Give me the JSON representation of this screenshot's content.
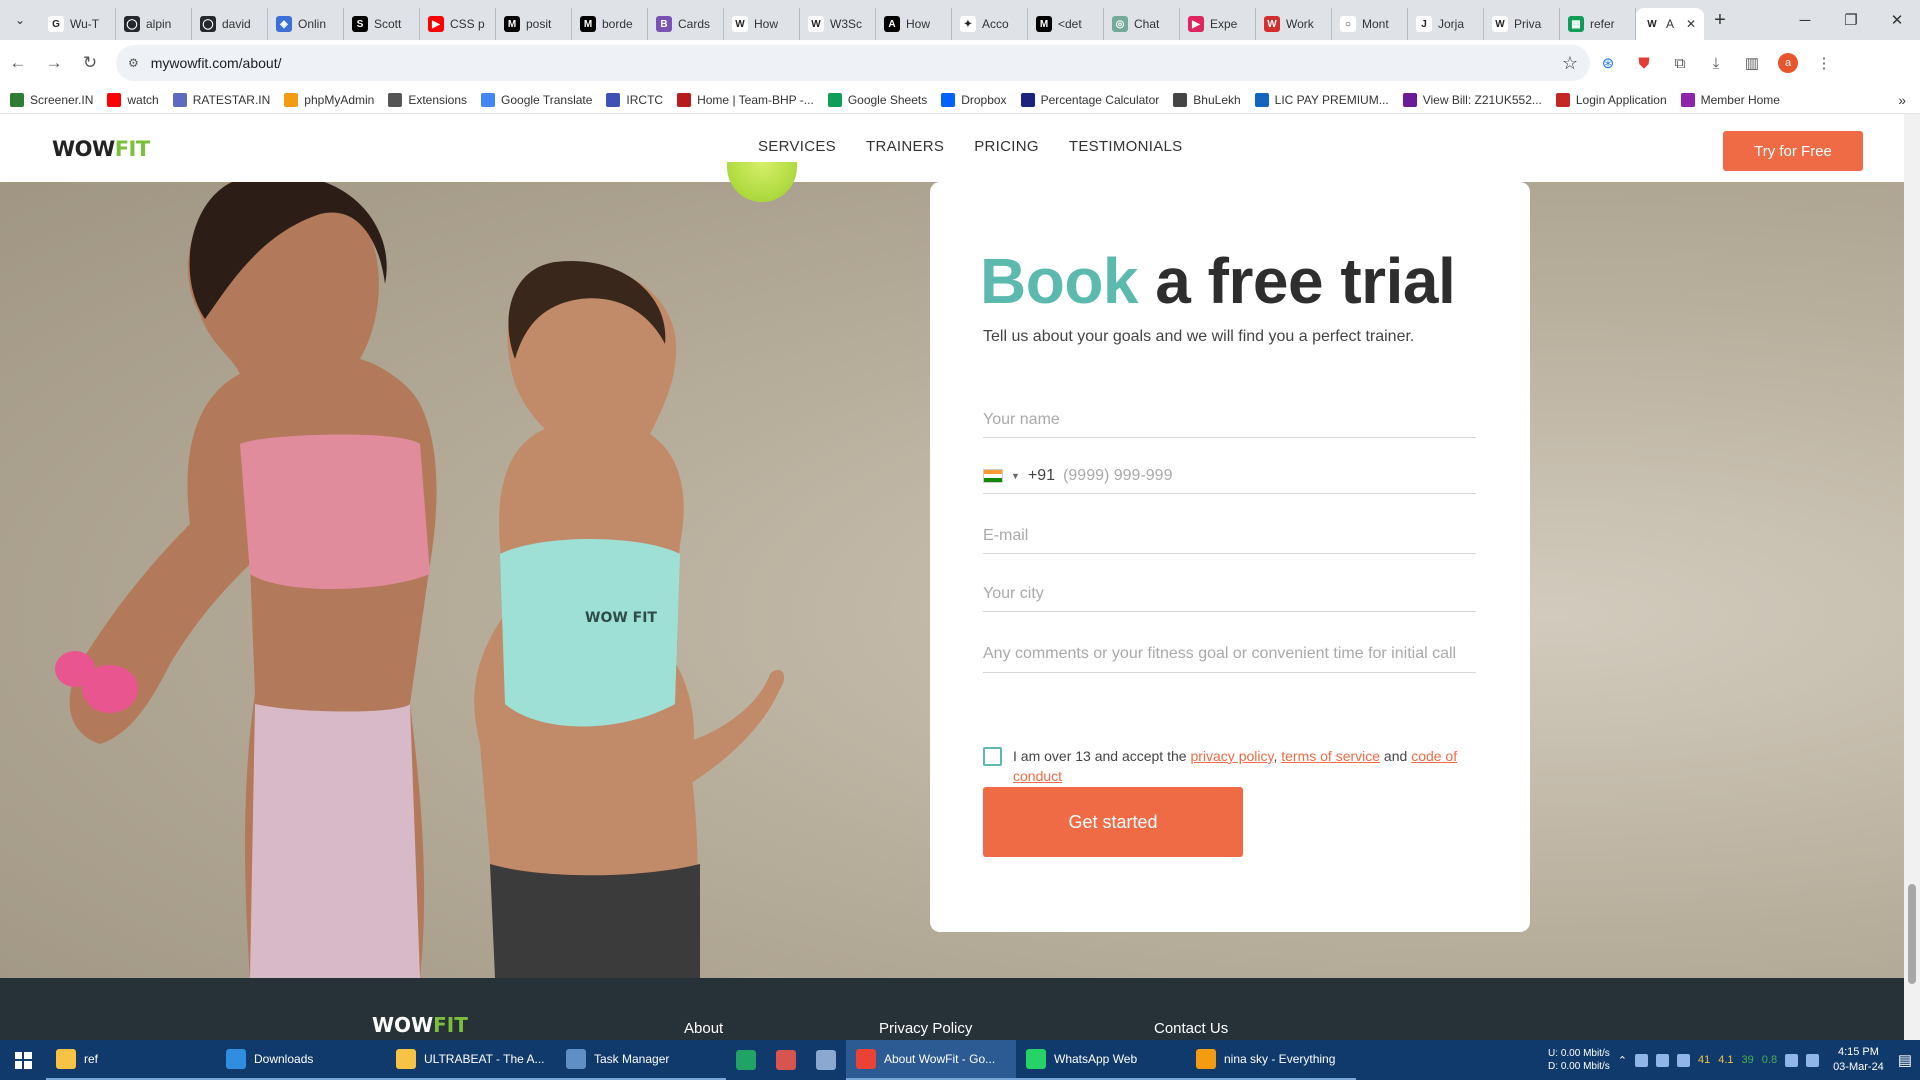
{
  "browser": {
    "tabs": [
      {
        "label": "Wu-T",
        "color": "#ffffff",
        "glyph": "G"
      },
      {
        "label": "alpin",
        "color": "#24292f",
        "glyph": "◯"
      },
      {
        "label": "david",
        "color": "#24292f",
        "glyph": "◯"
      },
      {
        "label": "Onlin",
        "color": "#3d6fd8",
        "glyph": "◈"
      },
      {
        "label": "Scott",
        "color": "#000000",
        "glyph": "S"
      },
      {
        "label": "CSS p",
        "color": "#ff0000",
        "glyph": "▶"
      },
      {
        "label": "posit",
        "color": "#000000",
        "glyph": "M"
      },
      {
        "label": "borde",
        "color": "#000000",
        "glyph": "M"
      },
      {
        "label": "Cards",
        "color": "#7952b3",
        "glyph": "B"
      },
      {
        "label": "How",
        "color": "#ffffff",
        "glyph": "W"
      },
      {
        "label": "W3Sc",
        "color": "#ffffff",
        "glyph": "W"
      },
      {
        "label": "How",
        "color": "#000000",
        "glyph": "A"
      },
      {
        "label": "Acco",
        "color": "#ffffff",
        "glyph": "✦"
      },
      {
        "label": "<det",
        "color": "#000000",
        "glyph": "M"
      },
      {
        "label": "Chat",
        "color": "#74aa9c",
        "glyph": "◎"
      },
      {
        "label": "Expe",
        "color": "#e0245e",
        "glyph": "▶"
      },
      {
        "label": "Work",
        "color": "#d32f2f",
        "glyph": "W"
      },
      {
        "label": "Mont",
        "color": "#ffffff",
        "glyph": "○"
      },
      {
        "label": "Jorja",
        "color": "#ffffff",
        "glyph": "J"
      },
      {
        "label": "Priva",
        "color": "#ffffff",
        "glyph": "W"
      },
      {
        "label": "refer",
        "color": "#0f9d58",
        "glyph": "▦"
      }
    ],
    "active_tab": {
      "label": "A",
      "glyph": "W"
    },
    "url": "mywowfit.com/about/",
    "profile_initial": "a",
    "bookmarks": [
      {
        "label": "Screener.IN",
        "color": "#2e7d32"
      },
      {
        "label": "watch",
        "color": "#ff0000"
      },
      {
        "label": "RATESTAR.IN",
        "color": "#5c6bc0"
      },
      {
        "label": "phpMyAdmin",
        "color": "#f39c12"
      },
      {
        "label": "Extensions",
        "color": "#555555"
      },
      {
        "label": "Google Translate",
        "color": "#4285f4"
      },
      {
        "label": "IRCTC",
        "color": "#3f51b5"
      },
      {
        "label": "Home | Team-BHP -...",
        "color": "#b71c1c"
      },
      {
        "label": "Google Sheets",
        "color": "#0f9d58"
      },
      {
        "label": "Dropbox",
        "color": "#0061fe"
      },
      {
        "label": "Percentage Calculator",
        "color": "#1a237e"
      },
      {
        "label": "BhuLekh",
        "color": "#444444"
      },
      {
        "label": "LIC PAY PREMIUM...",
        "color": "#1565c0"
      },
      {
        "label": "View Bill: Z21UK552...",
        "color": "#6a1b9a"
      },
      {
        "label": "Login Application",
        "color": "#c62828"
      },
      {
        "label": "Member Home",
        "color": "#8e24aa"
      }
    ],
    "bookmarks_more": "»"
  },
  "site": {
    "logo_main": "WOW",
    "logo_accent": "FIT",
    "nav": [
      "SERVICES",
      "TRAINERS",
      "PRICING",
      "TESTIMONIALS"
    ],
    "cta": "Try for Free",
    "photo_tank_text": "WOW FIT"
  },
  "form": {
    "title_accent": "Book",
    "title_rest": " a free trial",
    "subtitle": "Tell us about your goals and we will find you a perfect trainer.",
    "name_placeholder": "Your name",
    "country_code": "+91",
    "phone_placeholder": "(9999) 999-999",
    "email_placeholder": "E-mail",
    "city_placeholder": "Your city",
    "comments_placeholder": "Any comments or your fitness goal or convenient time for initial call",
    "terms_prefix": "I am over 13 and accept the ",
    "privacy_link": "privacy policy",
    "sep": ", ",
    "tos_link": "terms of service",
    "and": " and ",
    "coc_link": "code of conduct",
    "submit": "Get started"
  },
  "footer": {
    "links": [
      "About",
      "Privacy Policy",
      "Contact Us"
    ]
  },
  "taskbar": {
    "items": [
      {
        "label": "ref",
        "color": "#f6c344",
        "active": false
      },
      {
        "label": "Downloads",
        "color": "#2f8ee0",
        "active": false
      },
      {
        "label": "ULTRABEAT - The A...",
        "color": "#f6c344",
        "active": false
      },
      {
        "label": "Task Manager",
        "color": "#5f8fc4",
        "active": false
      },
      {
        "label": "",
        "color": "#21a366",
        "active": false
      },
      {
        "label": "",
        "color": "#d9534f",
        "active": false
      },
      {
        "label": "",
        "color": "#8aa8d0",
        "active": false
      },
      {
        "label": "About WowFit - Go...",
        "color": "#ea4335",
        "active": true
      },
      {
        "label": "WhatsApp Web",
        "color": "#25d366",
        "active": false
      },
      {
        "label": "nina sky - Everything",
        "color": "#f39c12",
        "active": false
      }
    ],
    "net_up": "U:   0.00 Mbit/s",
    "net_down": "D:   0.00 Mbit/s",
    "tray_nums": [
      "41",
      "4.1",
      "39",
      "0.8"
    ],
    "time": "4:15 PM",
    "date": "03-Mar-24"
  }
}
